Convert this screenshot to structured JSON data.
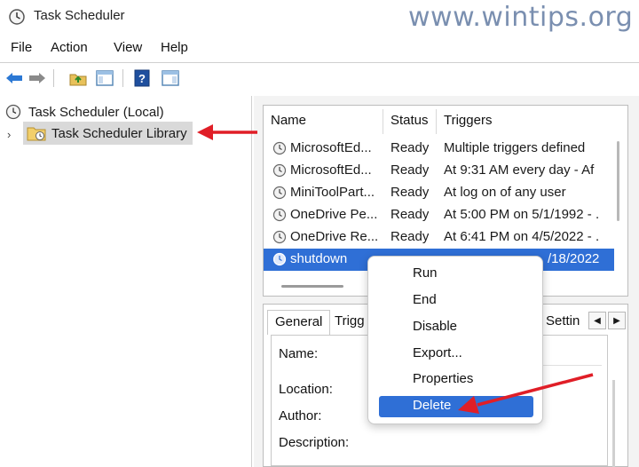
{
  "window": {
    "title": "Task Scheduler"
  },
  "watermark": "www.wintips.org",
  "menu": [
    "File",
    "Action",
    "View",
    "Help"
  ],
  "toolbar": {
    "icons": [
      "back-arrow-icon",
      "forward-arrow-icon",
      "folder-up-icon",
      "show-hide-tree-icon",
      "help-icon",
      "show-hide-action-pane-icon"
    ]
  },
  "tree": {
    "root": "Task Scheduler (Local)",
    "library": "Task Scheduler Library"
  },
  "tasks": {
    "columns": [
      "Name",
      "Status",
      "Triggers"
    ],
    "rows": [
      {
        "name": "MicrosoftEd...",
        "status": "Ready",
        "trigger": "Multiple triggers defined"
      },
      {
        "name": "MicrosoftEd...",
        "status": "Ready",
        "trigger": "At 9:31 AM every day - Af"
      },
      {
        "name": "MiniToolPart...",
        "status": "Ready",
        "trigger": "At log on of any user"
      },
      {
        "name": "OneDrive Pe...",
        "status": "Ready",
        "trigger": "At 5:00 PM on 5/1/1992 - ."
      },
      {
        "name": "OneDrive Re...",
        "status": "Ready",
        "trigger": "At 6:41 PM on 4/5/2022 - ."
      },
      {
        "name": "shutdown",
        "status": "",
        "trigger": "/18/2022"
      }
    ]
  },
  "props": {
    "tabs": [
      "General",
      "Trigg",
      "Settin"
    ],
    "fields": [
      "Name:",
      "Location:",
      "Author:",
      "Description:"
    ]
  },
  "context_menu": {
    "items": [
      "Run",
      "End",
      "Disable",
      "Export...",
      "Properties",
      "Delete"
    ],
    "selected": "Delete"
  },
  "colors": {
    "selection": "#2f6fd6",
    "annotation_arrow": "#e01e27"
  }
}
